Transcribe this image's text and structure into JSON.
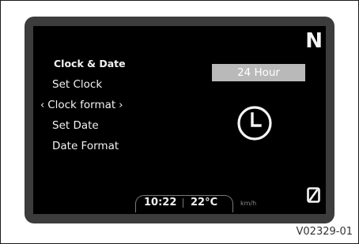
{
  "menu": {
    "title": "Clock & Date",
    "items": [
      {
        "label": "Set Clock"
      },
      {
        "label": "Clock format",
        "selected": true
      },
      {
        "label": "Set Date"
      },
      {
        "label": "Date Format"
      }
    ],
    "chevron_left": "‹",
    "chevron_right": "›"
  },
  "gear_indicator": "N",
  "clock_format_value": "24 Hour",
  "status_bar": {
    "time": "10:22",
    "temperature": "22°C",
    "speed_unit": "km/h"
  },
  "icons": {
    "clock": "clock-icon",
    "zero_trip": "zero-icon"
  },
  "figure_code": "V02329-01",
  "colors": {
    "bezel": "#3c3c3c",
    "screen": "#000000",
    "highlight": "#b9b9b9",
    "text": "#f2f2f2"
  }
}
